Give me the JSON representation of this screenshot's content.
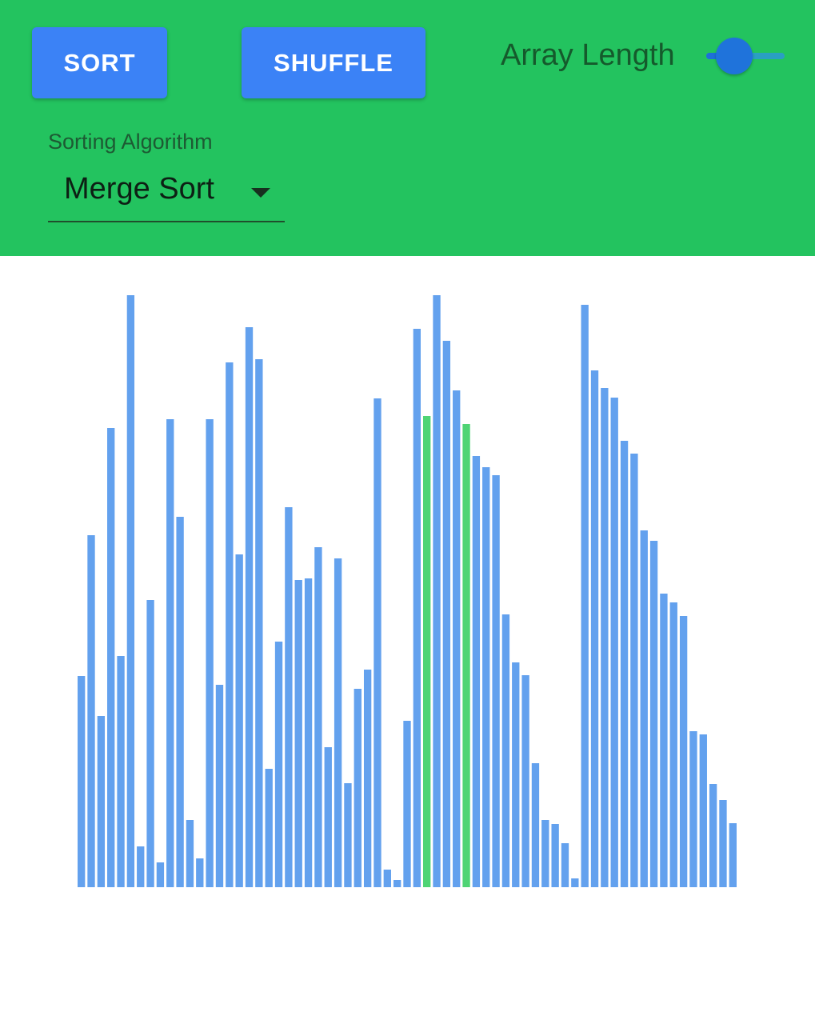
{
  "toolbar": {
    "sort_label": "SORT",
    "shuffle_label": "SHUFFLE",
    "array_length_label": "Array Length",
    "array_length_fraction": 0.3
  },
  "algorithm": {
    "label": "Sorting Algorithm",
    "selected": "Merge Sort"
  },
  "colors": {
    "header_bg": "#23c35f",
    "button_bg": "#3b82f6",
    "bar_default": "#63a1ee",
    "bar_highlight": "#4fd475"
  },
  "chart_data": {
    "type": "bar",
    "values": [
      264,
      440,
      214,
      574,
      289,
      740,
      51,
      359,
      31,
      585,
      463,
      84,
      36,
      585,
      253,
      656,
      416,
      700,
      660,
      148,
      307,
      475,
      384,
      386,
      425,
      175,
      411,
      130,
      248,
      272,
      611,
      22,
      9,
      208,
      698,
      589,
      740,
      683,
      621,
      579,
      539,
      525,
      515,
      341,
      281,
      265,
      155,
      84,
      79,
      55,
      11,
      728,
      646,
      624,
      612,
      558,
      542,
      446,
      433,
      367,
      356,
      339,
      195,
      191,
      129,
      109,
      80
    ],
    "highlight": [
      35,
      39
    ],
    "ylim": [
      0,
      740
    ]
  }
}
